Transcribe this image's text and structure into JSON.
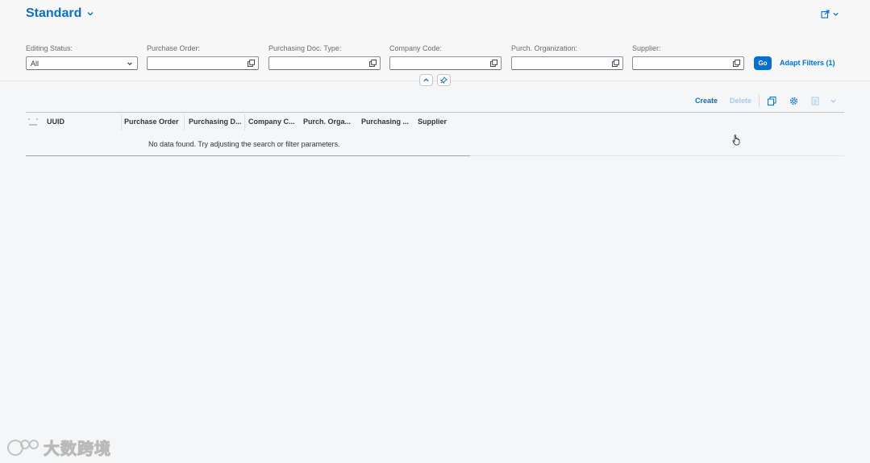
{
  "header": {
    "variant_title": "Standard",
    "share_icon": "share-icon"
  },
  "filters": [
    {
      "label": "Editing Status:",
      "value": "All",
      "type": "select"
    },
    {
      "label": "Purchase Order:",
      "value": "",
      "type": "value-help"
    },
    {
      "label": "Purchasing Doc. Type:",
      "value": "",
      "type": "value-help"
    },
    {
      "label": "Company Code:",
      "value": "",
      "type": "value-help"
    },
    {
      "label": "Purch. Organization:",
      "value": "",
      "type": "value-help"
    },
    {
      "label": "Supplier:",
      "value": "",
      "type": "value-help"
    }
  ],
  "filterbar": {
    "go_label": "Go",
    "adapt_label": "Adapt Filters (1)"
  },
  "toolbar": {
    "create_label": "Create",
    "delete_label": "Delete"
  },
  "table": {
    "columns": [
      "UUID",
      "Purchase Order",
      "Purchasing D...",
      "Company C...",
      "Purch. Orga...",
      "Purchasing ...",
      "Supplier"
    ],
    "no_data": "No data found. Try adjusting the search or filter parameters."
  },
  "watermark": {
    "text": "大数跨境"
  },
  "colors": {
    "accent": "#0a6ed1",
    "background": "#f5f6f7"
  }
}
